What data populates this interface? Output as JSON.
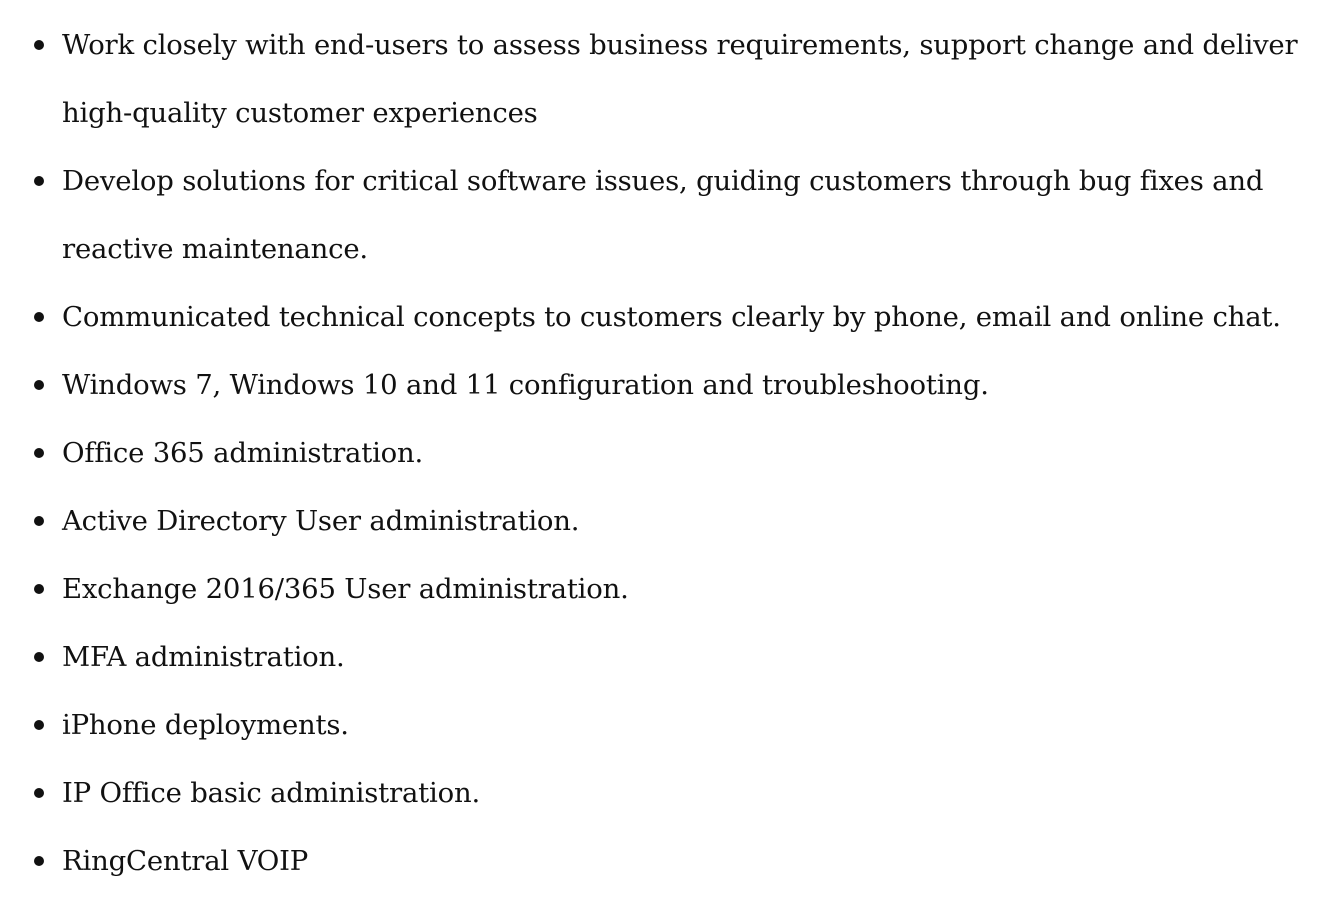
{
  "bullets": [
    {
      "lines": [
        "Work closely with end-users to assess business requirements, support change and deliver",
        "high-quality customer experiences"
      ]
    },
    {
      "lines": [
        "Develop solutions for critical software issues, guiding customers through bug fixes and",
        "reactive maintenance."
      ]
    },
    {
      "lines": [
        "Communicated technical concepts to customers clearly by phone, email and online chat."
      ]
    },
    {
      "lines": [
        "Windows 7, Windows 10 and 11 configuration and troubleshooting."
      ]
    },
    {
      "lines": [
        "Office 365 administration."
      ]
    },
    {
      "lines": [
        "Active Directory User administration."
      ]
    },
    {
      "lines": [
        "Exchange 2016/365 User administration."
      ]
    },
    {
      "lines": [
        "MFA administration."
      ]
    },
    {
      "lines": [
        "iPhone deployments."
      ]
    },
    {
      "lines": [
        "IP Office basic administration."
      ]
    },
    {
      "lines": [
        "RingCentral VOIP"
      ]
    }
  ]
}
